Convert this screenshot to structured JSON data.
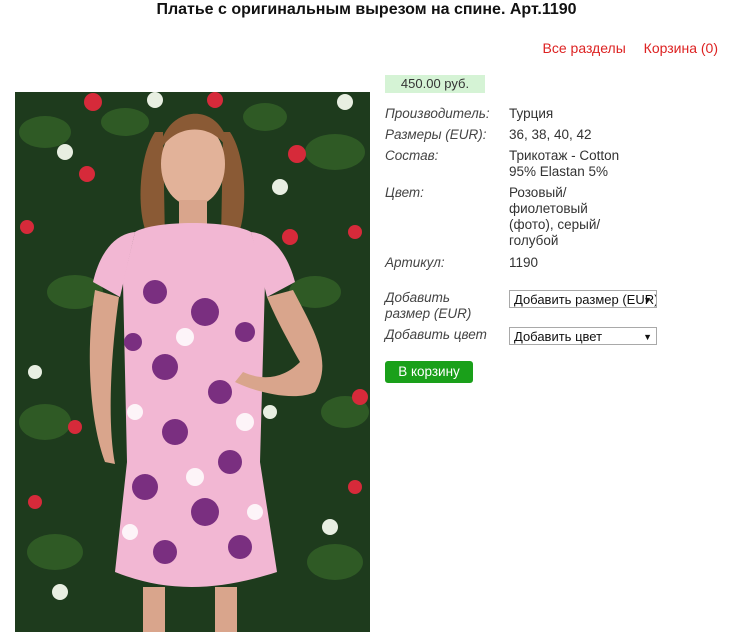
{
  "page_title": "Платье с оригинальным вырезом на спине. Арт.1190",
  "nav": {
    "all_sections": "Все разделы",
    "cart": "Корзина (0)"
  },
  "price": "450.00 руб.",
  "details": {
    "manufacturer_label": "Производитель:",
    "manufacturer_value": "Турция",
    "sizes_label": "Размеры (EUR):",
    "sizes_value": "36, 38, 40, 42",
    "composition_label": "Состав:",
    "composition_value": "Трикотаж - Cotton 95% Elastan 5%",
    "color_label": "Цвет:",
    "color_value": "Розовый/ фиолетовый (фото), серый/ голубой",
    "article_label": "Артикул:",
    "article_value": "1190"
  },
  "form": {
    "add_size_label": "Добавить размер (EUR)",
    "add_size_select": "Добавить размер (EUR)",
    "add_color_label": "Добавить цвет",
    "add_color_select": "Добавить цвет"
  },
  "add_to_cart": "В корзину",
  "colors": {
    "link": "#dd2222",
    "button": "#1aa01a",
    "price_bg": "#d5f3d5",
    "dress": "#f0b0d0",
    "flowers": "#7a2f80"
  }
}
